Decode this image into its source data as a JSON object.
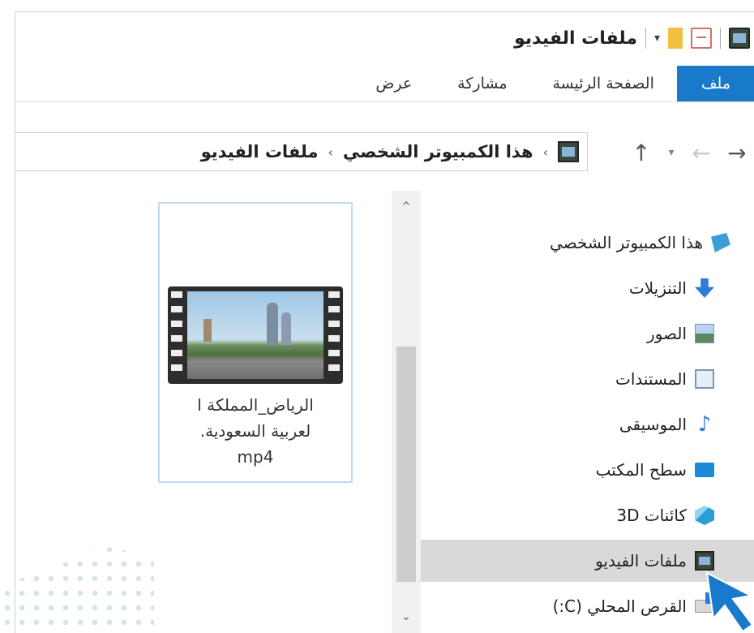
{
  "window": {
    "title": "ملفات الفيديو",
    "quick_access": {
      "dropdown_glyph": "▾"
    }
  },
  "ribbon": {
    "tabs": [
      "ملف",
      "الصفحة الرئيسة",
      "مشاركة",
      "عرض"
    ]
  },
  "navigation": {
    "back_glyph": "←",
    "forward_glyph": "→",
    "recent_glyph": "▾",
    "up_glyph": "↑"
  },
  "address": {
    "separator_glyph": "›",
    "breadcrumb": [
      "هذا الكمبيوتر الشخصي",
      "ملفات الفيديو"
    ]
  },
  "nav_pane": {
    "items": [
      {
        "label": "هذا الكمبيوتر الشخصي",
        "icon": "computer-icon"
      },
      {
        "label": "التنزيلات",
        "icon": "downloads-icon"
      },
      {
        "label": "الصور",
        "icon": "pictures-icon"
      },
      {
        "label": "المستندات",
        "icon": "documents-icon"
      },
      {
        "label": "الموسيقى",
        "icon": "music-icon"
      },
      {
        "label": "سطح المكتب",
        "icon": "desktop-icon"
      },
      {
        "label": "كائنات 3D",
        "icon": "3d-objects-icon"
      },
      {
        "label": "ملفات الفيديو",
        "icon": "videos-icon",
        "selected": true
      },
      {
        "label": "القرص المحلي (C:)",
        "icon": "local-disk-icon"
      }
    ]
  },
  "scrollbar": {
    "up_glyph": "^",
    "down_glyph": "⌄"
  },
  "content": {
    "files": [
      {
        "name_lines": [
          "الرياض_المملكة ا",
          "لعربية السعودية.",
          "mp4"
        ],
        "type_icon": "video-file-icon"
      }
    ]
  },
  "colors": {
    "ribbon_file_tab": "#1979ca",
    "selection": "#d9d9d9",
    "file_tile_border": "#bcdcf4",
    "cursor": "#1979ca"
  }
}
